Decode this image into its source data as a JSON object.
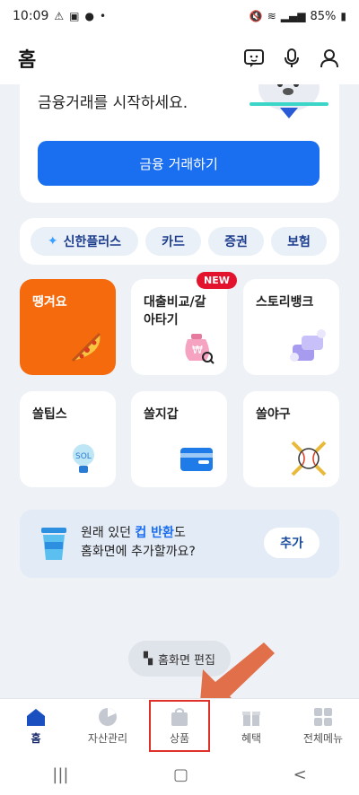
{
  "status_bar": {
    "time": "10:09",
    "battery": "85%"
  },
  "header": {
    "title": "홈"
  },
  "hero": {
    "text": "금융거래를 시작하세요.",
    "button_label": "금융 거래하기"
  },
  "categories": [
    {
      "label": "신한플러스"
    },
    {
      "label": "카드"
    },
    {
      "label": "증권"
    },
    {
      "label": "보험"
    }
  ],
  "tiles": [
    {
      "label": "땡겨요"
    },
    {
      "label": "대출비교/갈아타기",
      "line1": "대출비교/갈",
      "line2": "아타기",
      "badge": "NEW"
    },
    {
      "label": "스토리뱅크"
    },
    {
      "label": "쏠팁스"
    },
    {
      "label": "쏠지갑"
    },
    {
      "label": "쏠야구"
    }
  ],
  "promo": {
    "line1_a": "원래 있던 ",
    "line1_hl": "컵 반환",
    "line1_b": "도",
    "line2": "홈화면에 추가할까요?",
    "button_label": "추가"
  },
  "edit_pill": {
    "label": "홈화면 편집"
  },
  "tabs": [
    {
      "label": "홈"
    },
    {
      "label": "자산관리"
    },
    {
      "label": "상품"
    },
    {
      "label": "혜택"
    },
    {
      "label": "전체메뉴"
    }
  ],
  "colors": {
    "accent": "#1a6ef0",
    "orange": "#f46a0c",
    "highlight": "#e0302a"
  }
}
